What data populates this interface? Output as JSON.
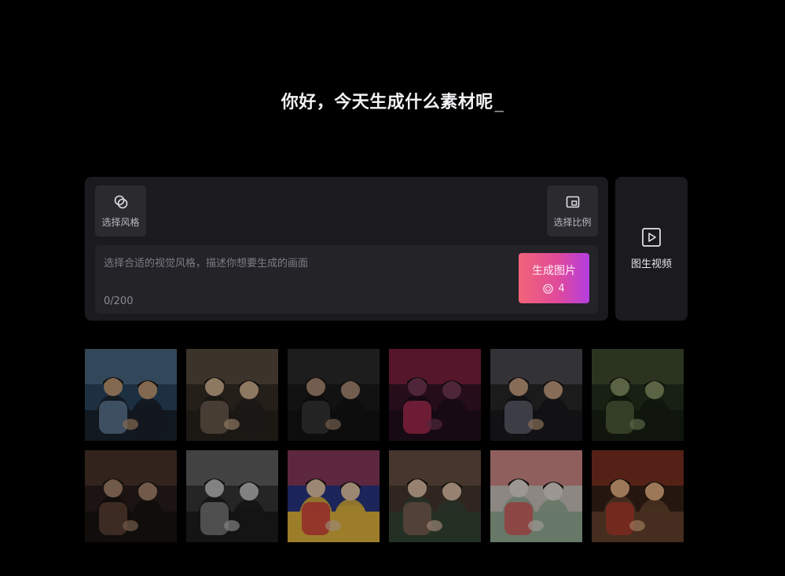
{
  "header": {
    "greeting": "你好，今天生成什么素材呢",
    "cursor": "_"
  },
  "prompt_card": {
    "style_button_label": "选择风格",
    "style_button_icon": "overlapping-circles-icon",
    "ratio_button_label": "选择比例",
    "ratio_button_icon": "aspect-ratio-icon",
    "input": {
      "placeholder": "选择合适的视觉风格，描述你想要生成的画面",
      "value": "",
      "counter": "0/200"
    },
    "generate_button": {
      "label": "生成图片",
      "cost": "4",
      "cost_icon": "coin-icon",
      "gradient": [
        "#f06478",
        "#e04a9a",
        "#b43de0"
      ]
    }
  },
  "video_card": {
    "label": "图生视频",
    "icon": "play-square-icon"
  },
  "gallery": {
    "rows": [
      [
        {
          "style": "photo-cafe-couple-cat",
          "palette": [
            "#2d4a66",
            "#6a8aa8",
            "#1d2530",
            "#c9a27a"
          ]
        },
        {
          "style": "photo-living-room-couple",
          "palette": [
            "#3a3028",
            "#7a6a58",
            "#2a2520",
            "#d9b896"
          ]
        },
        {
          "style": "photo-dark-portrait-couple",
          "palette": [
            "#1c1c1c",
            "#3c3c3c",
            "#141414",
            "#b09078"
          ]
        },
        {
          "style": "photo-neon-vr-couple",
          "palette": [
            "#3a1628",
            "#c0305a",
            "#241020",
            "#7a3a58"
          ]
        },
        {
          "style": "photo-sofa-couple-cat",
          "palette": [
            "#2c2a2a",
            "#6a6a78",
            "#1c1c20",
            "#d0a888"
          ]
        },
        {
          "style": "photo-green-tone-couple",
          "palette": [
            "#26321e",
            "#5a6a40",
            "#1a2214",
            "#8a9a6a"
          ]
        }
      ],
      [
        {
          "style": "photo-dim-room-couple",
          "palette": [
            "#2a201c",
            "#6a4a3c",
            "#1a1412",
            "#b08a72"
          ]
        },
        {
          "style": "photo-bw-couple-cat",
          "palette": [
            "#3a3a3a",
            "#8a8a8a",
            "#202020",
            "#c8c8c8"
          ]
        },
        {
          "style": "anime-retro-couple-sofa",
          "palette": [
            "#2a3a8a",
            "#e04040",
            "#f0c040",
            "#f0d0b0"
          ]
        },
        {
          "style": "anime-ghibli-couple",
          "palette": [
            "#4a3a30",
            "#8a6a58",
            "#3a4a3a",
            "#e8c8b0"
          ]
        },
        {
          "style": "anime-sketch-children-sofa",
          "palette": [
            "#d8d0c8",
            "#e06060",
            "#a0b8a0",
            "#f0e8e0"
          ]
        },
        {
          "style": "3d-cartoon-kids-sofa",
          "palette": [
            "#3a2418",
            "#c04030",
            "#6a4830",
            "#f0b888"
          ]
        }
      ]
    ]
  }
}
